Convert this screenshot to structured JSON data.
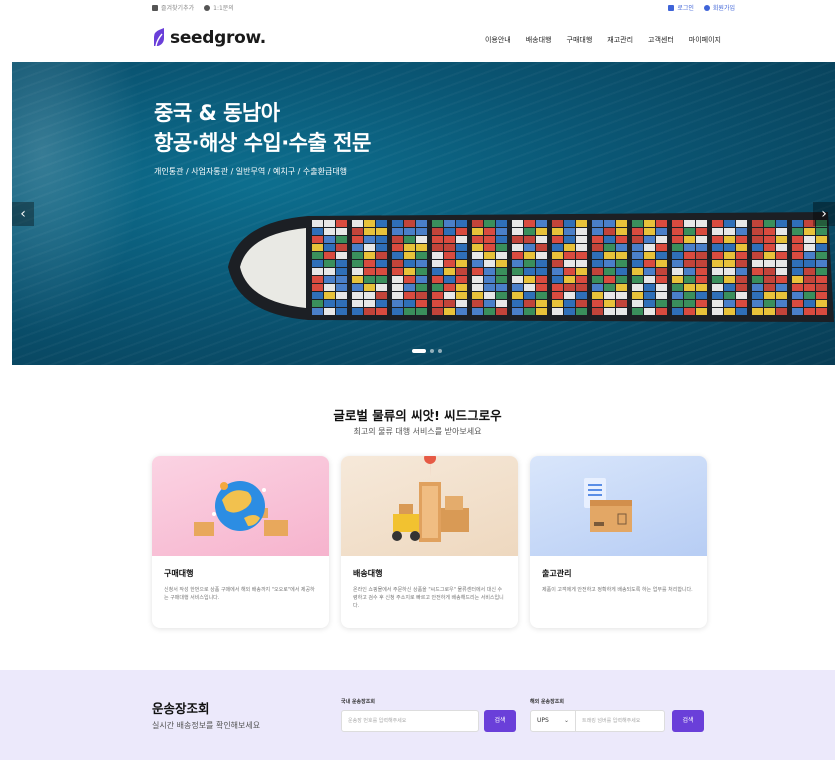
{
  "topbar": {
    "bookmark": "즐겨찾기추가",
    "inquiry": "1:1문의",
    "login": "로그인",
    "signup": "회원가입"
  },
  "header": {
    "logo": "seedgrow.",
    "nav": [
      "이용안내",
      "배송대행",
      "구매대행",
      "재고관리",
      "고객센터",
      "마이페이지"
    ]
  },
  "hero": {
    "title_line1": "중국 & 동남아",
    "title_line2": "항공·해상 수입·수출 전문",
    "subtitle": "개인통관 / 사업자통관 / 일반무역 / 예치구 / 수출환급대행",
    "prev": "‹",
    "next": "›",
    "slides": 3,
    "active_slide": 1
  },
  "intro": {
    "title": "글로벌 물류의 씨앗! 씨드그로우",
    "subtitle": "최고의 물류 대행 서비스를 받아보세요"
  },
  "cards": [
    {
      "title": "구매대행",
      "desc": "신청서 작성 한번으로 상품 구매에서 해외 배송까지 \"오오로\"에서 제공하는 구매대행 서비스입니다.",
      "bg": "#f9c5d8"
    },
    {
      "title": "배송대행",
      "desc": "온라인 쇼핑몰에서 주문하신 상품을 \"씨드그로우\" 물류센터에서 대신 수령하고 검수 후 신청 주소지로 빠르고 안전하게 배송해드리는 서비스입니다.",
      "bg": "#f3e2cf"
    },
    {
      "title": "출고관리",
      "desc": "제품이 고객에게 안전하고 정확하게 배송되도록 하는 업무를 처리합니다.",
      "bg": "#c9daf7"
    }
  ],
  "tracking": {
    "title": "운송장조회",
    "subtitle": "실시간 배송정보를 확인해보세요",
    "domestic_label": "국내 운송장조회",
    "domestic_placeholder": "운송장 번호를 입력해주세요",
    "overseas_label": "해외 운송장조회",
    "carrier": "UPS",
    "overseas_placeholder": "트래킹 넘버를 입력해주세요",
    "search": "검색"
  },
  "colors": {
    "accent": "#6a3fd9",
    "link": "#3f64d8",
    "track_bg": "#ece9fb"
  }
}
